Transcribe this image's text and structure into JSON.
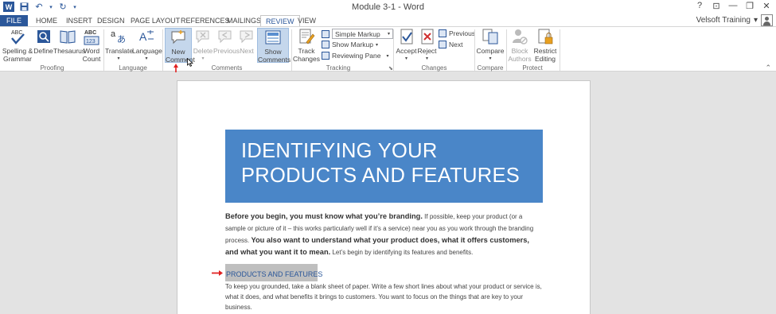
{
  "window": {
    "title": "Module 3-1 - Word",
    "controls": [
      "?",
      "⊡",
      "—",
      "❐",
      "✕"
    ]
  },
  "qat": {
    "app_icon": "W",
    "save_icon": "save-icon",
    "undo_icon": "undo-icon",
    "redo_icon": "redo-icon"
  },
  "tabs": [
    {
      "label": "FILE"
    },
    {
      "label": "HOME"
    },
    {
      "label": "INSERT"
    },
    {
      "label": "DESIGN"
    },
    {
      "label": "PAGE LAYOUT"
    },
    {
      "label": "REFERENCES"
    },
    {
      "label": "MAILINGS"
    },
    {
      "label": "REVIEW"
    },
    {
      "label": "VIEW"
    }
  ],
  "user": {
    "name": "Velsoft Training",
    "caret": "▾"
  },
  "ribbon": {
    "proofing": {
      "label": "Proofing",
      "spelling_line1": "Spelling &",
      "spelling_line2": "Grammar",
      "define": "Define",
      "thesaurus": "Thesaurus",
      "wordcount_line1": "Word",
      "wordcount_line2": "Count"
    },
    "language": {
      "label": "Language",
      "translate": "Translate",
      "language": "Language"
    },
    "comments": {
      "label": "Comments",
      "new_line1": "New",
      "new_line2": "Comment",
      "delete": "Delete",
      "previous": "Previous",
      "next": "Next",
      "show_line1": "Show",
      "show_line2": "Comments"
    },
    "tracking": {
      "label": "Tracking",
      "track_line1": "Track",
      "track_line2": "Changes",
      "markup_select": "Simple Markup",
      "show_markup": "Show Markup",
      "reviewing_pane": "Reviewing Pane"
    },
    "changes": {
      "label": "Changes",
      "accept": "Accept",
      "reject": "Reject",
      "previous": "Previous",
      "next": "Next"
    },
    "compare": {
      "label": "Compare",
      "compare": "Compare"
    },
    "protect": {
      "label": "Protect",
      "block_line1": "Block",
      "block_line2": "Authors",
      "restrict_line1": "Restrict",
      "restrict_line2": "Editing"
    }
  },
  "document": {
    "banner_line1": "IDENTIFYING YOUR",
    "banner_line2": "PRODUCTS AND FEATURES",
    "p1_bold1": "Before you begin, you must know what you’re branding.",
    "p1_text1": " If possible, keep your product (or a sample or picture of it – this works particularly well if it’s a service) near you as you work through the branding process. ",
    "p1_bold2": "You also want to understand what your product does, what it offers customers, and what you want it to mean.",
    "p1_text2": " Let’s begin by identifying its features and benefits.",
    "heading": "PRODUCTS AND FEATURES",
    "p2": "To keep you grounded, take a blank sheet of paper. Write a few short lines about what your product or service is, what it does, and what benefits it brings to customers. You want to focus on the things that are key to your business."
  },
  "colors": {
    "accent": "#2b579a",
    "banner": "#4a86c8",
    "highlight": "#bfbfbf",
    "annotation_arrow": "#e02020"
  }
}
